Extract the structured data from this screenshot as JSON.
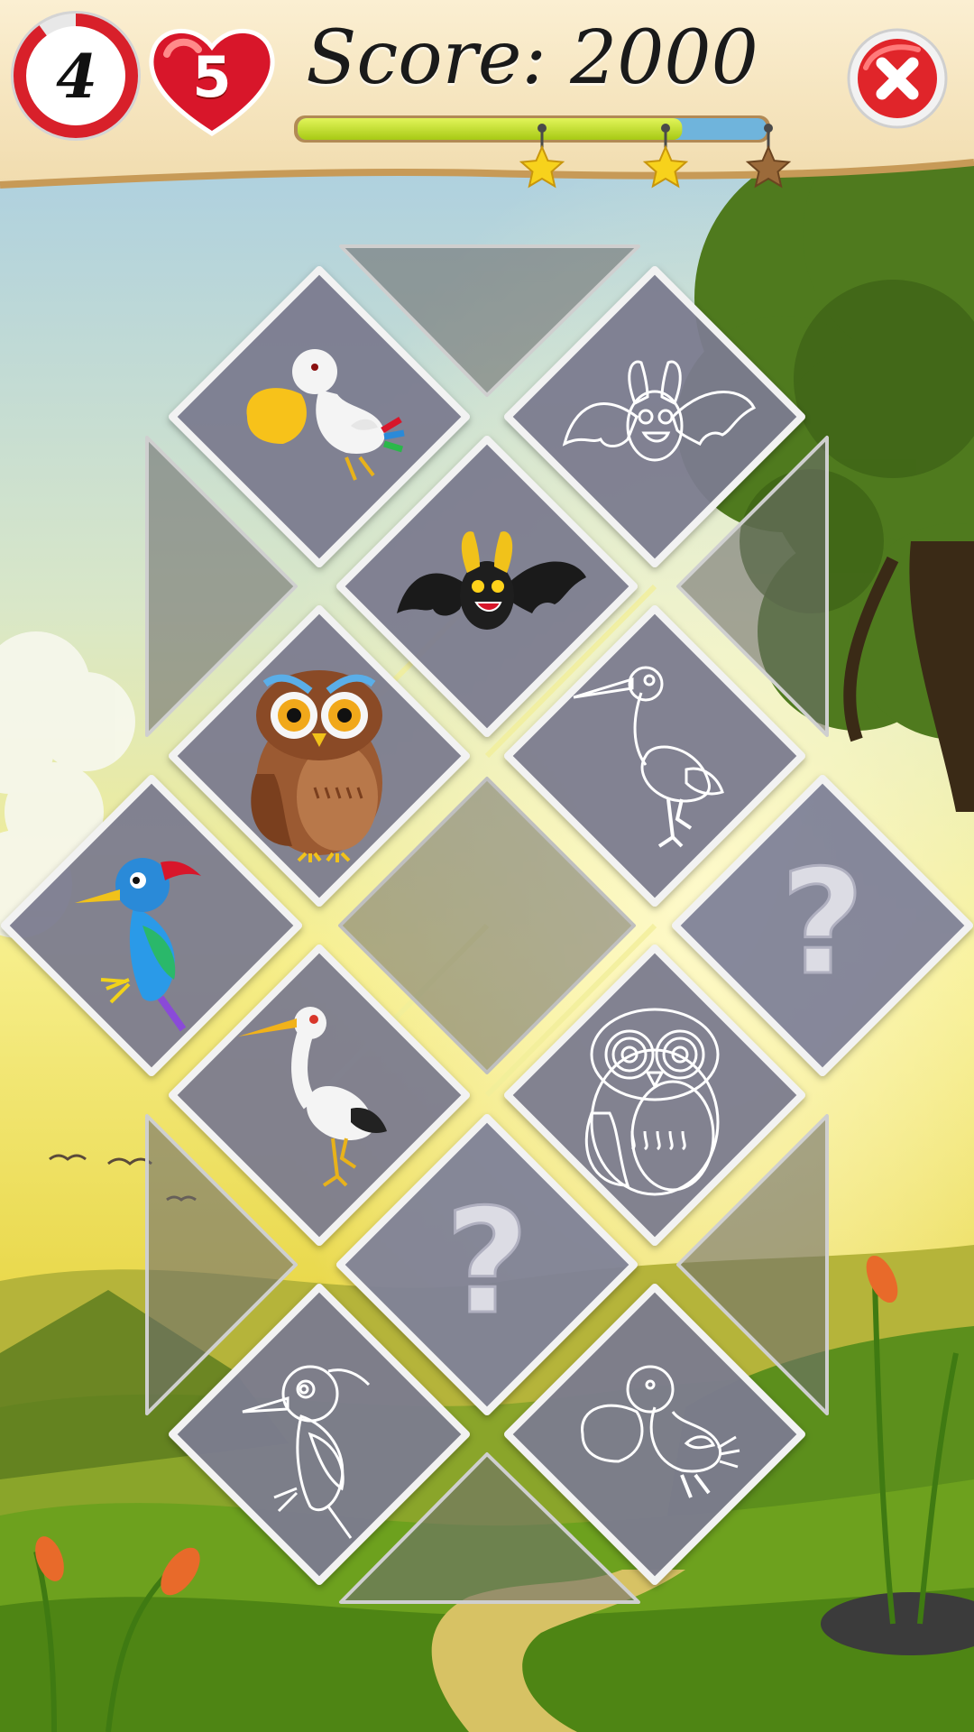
{
  "hud": {
    "timer_value": "4",
    "lives_value": "5",
    "score_text": "Score: 2000",
    "progress_fraction": 0.82,
    "stars_earned": 2,
    "stars_total": 3
  },
  "board": {
    "tiles": [
      {
        "id": "tile-pelican",
        "state": "revealed-color",
        "animal": "pelican"
      },
      {
        "id": "tile-bat-outline",
        "state": "revealed-outline",
        "animal": "bat"
      },
      {
        "id": "tile-bat",
        "state": "revealed-color",
        "animal": "bat"
      },
      {
        "id": "tile-owl",
        "state": "revealed-color",
        "animal": "owl"
      },
      {
        "id": "tile-heron-outline",
        "state": "revealed-outline",
        "animal": "heron"
      },
      {
        "id": "tile-woodpecker",
        "state": "revealed-color",
        "animal": "woodpecker"
      },
      {
        "id": "tile-empty-center",
        "state": "empty",
        "animal": ""
      },
      {
        "id": "tile-question-right",
        "state": "hidden",
        "animal": ""
      },
      {
        "id": "tile-heron",
        "state": "revealed-color",
        "animal": "heron"
      },
      {
        "id": "tile-owl-outline",
        "state": "revealed-outline",
        "animal": "owl"
      },
      {
        "id": "tile-question-bottom",
        "state": "hidden",
        "animal": ""
      },
      {
        "id": "tile-woodpecker-outline",
        "state": "revealed-outline",
        "animal": "woodpecker"
      },
      {
        "id": "tile-pelican-outline",
        "state": "revealed-outline",
        "animal": "pelican"
      }
    ],
    "hidden_symbol": "?"
  },
  "colors": {
    "tile_fill": "#7d7d90",
    "tile_border": "#f2f2f2",
    "header_bg": "#f6e6c0",
    "progress_fill": "#c8e62a",
    "progress_track": "#6fb4dc",
    "close_button": "#e0252a",
    "heart": "#d8162a"
  },
  "icons": {
    "close": "close-icon",
    "timer": "timer-icon",
    "lives": "heart-icon",
    "star": "star-icon"
  }
}
